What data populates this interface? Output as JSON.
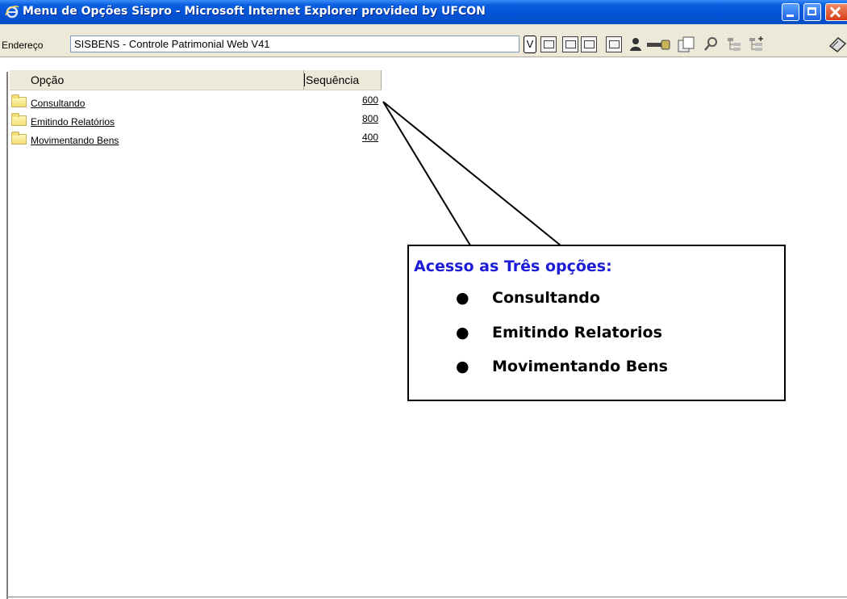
{
  "window": {
    "title": "Menu de Opções Sispro - Microsoft Internet Explorer provided by UFCON"
  },
  "addressbar": {
    "label": "Endereço",
    "value": "SISBENS - Controle Patrimonial Web V41",
    "v_button": "V"
  },
  "table": {
    "columns": [
      "Opção",
      "Sequência"
    ],
    "rows": [
      {
        "label": "Consultando",
        "sequence": "600"
      },
      {
        "label": "Emitindo Relatórios",
        "sequence": "800"
      },
      {
        "label": "Movimentando Bens",
        "sequence": "400"
      }
    ]
  },
  "callout": {
    "title": "Acesso as Três  opções:",
    "items": [
      "Consultando",
      "Emitindo Relatorios",
      "Movimentando  Bens"
    ],
    "title_color": "#1c1cd8"
  },
  "colors": {
    "titlebar": "#0452d6",
    "chrome": "#ece9d8"
  }
}
